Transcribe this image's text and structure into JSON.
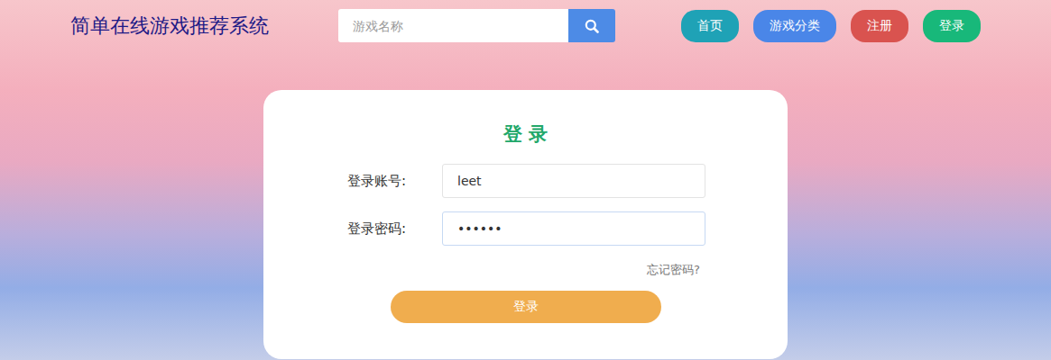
{
  "header": {
    "title": "简单在线游戏推荐系统",
    "search": {
      "placeholder": "游戏名称",
      "value": ""
    },
    "nav": [
      {
        "label": "首页",
        "color": "#1fa2b6"
      },
      {
        "label": "游戏分类",
        "color": "#4a86e8"
      },
      {
        "label": "注册",
        "color": "#d9534f"
      },
      {
        "label": "登录",
        "color": "#18b87a"
      }
    ]
  },
  "login_form": {
    "title": "登 录",
    "fields": [
      {
        "label": "登录账号:",
        "value": "leet",
        "focused": false
      },
      {
        "label": "登录密码:",
        "value": "••••••",
        "focused": true
      }
    ],
    "forgot_link": "忘记密码?",
    "submit": "登录"
  }
}
